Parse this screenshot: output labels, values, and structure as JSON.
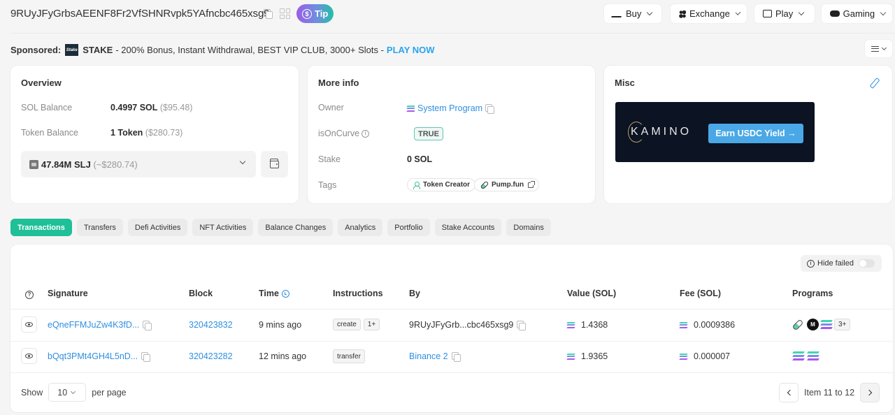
{
  "header": {
    "address": "9RUyJFyGrbsAEENF8Fr2VfSHNRvpk5YAfncbc465xsg9",
    "tip_label": "Tip",
    "nav": [
      {
        "label": "Buy",
        "icon": "buy-icon"
      },
      {
        "label": "Exchange",
        "icon": "exchange-icon"
      },
      {
        "label": "Play",
        "icon": "play-icon"
      },
      {
        "label": "Gaming",
        "icon": "gamepad-icon"
      }
    ]
  },
  "sponsored": {
    "label": "Sponsored:",
    "brand": "STAKE",
    "logo_text": "Stake",
    "text": "- 200% Bonus, Instant Withdrawal, BEST VIP CLUB, 3000+ Slots -",
    "cta": "PLAY NOW"
  },
  "overview": {
    "title": "Overview",
    "sol_balance_label": "SOL Balance",
    "sol_balance_value": "0.4997 SOL",
    "sol_balance_usd": "($95.48)",
    "token_balance_label": "Token Balance",
    "token_balance_value": "1 Token",
    "token_balance_usd": "($280.73)",
    "token_select_value": "47.84M SLJ",
    "token_select_usd": "(~$280.74)"
  },
  "more_info": {
    "title": "More info",
    "owner_label": "Owner",
    "owner_value": "System Program",
    "is_on_curve_label": "isOnCurve",
    "is_on_curve_value": "TRUE",
    "stake_label": "Stake",
    "stake_value": "0 SOL",
    "tags_label": "Tags",
    "tags": [
      "Token Creator",
      "Pump.fun"
    ]
  },
  "misc": {
    "title": "Misc",
    "ad_brand": "KAMINO",
    "ad_cta": "Earn USDC Yield →"
  },
  "tabs": [
    {
      "label": "Transactions",
      "active": true
    },
    {
      "label": "Transfers"
    },
    {
      "label": "Defi Activities"
    },
    {
      "label": "NFT Activities"
    },
    {
      "label": "Balance Changes"
    },
    {
      "label": "Analytics"
    },
    {
      "label": "Portfolio"
    },
    {
      "label": "Stake Accounts"
    },
    {
      "label": "Domains"
    }
  ],
  "table": {
    "hide_failed_label": "Hide failed",
    "hide_failed_on": false,
    "columns": [
      "Signature",
      "Block",
      "Time",
      "Instructions",
      "By",
      "Value (SOL)",
      "Fee (SOL)",
      "Programs"
    ],
    "rows": [
      {
        "signature": "eQneFFMJuZw4K3fD...",
        "block": "320423832",
        "time": "9 mins ago",
        "instructions": [
          "create",
          "1+"
        ],
        "by": "9RUyJFyGrb...cbc465xsg9",
        "by_is_link": false,
        "value": "1.4368",
        "fee": "0.0009386",
        "programs": [
          "pump-pill-icon",
          "dark-m-icon",
          "solana-icon"
        ],
        "programs_more": "3+"
      },
      {
        "signature": "bQqt3PMt4GH4L5nD...",
        "block": "320423282",
        "time": "12 mins ago",
        "instructions": [
          "transfer"
        ],
        "by": "Binance 2",
        "by_is_link": true,
        "value": "1.9365",
        "fee": "0.000007",
        "programs": [
          "solana-icon",
          "solana-icon"
        ],
        "programs_more": ""
      }
    ]
  },
  "pagination": {
    "show_label": "Show",
    "per_page_value": "10",
    "per_page_label": "per page",
    "range_text": "Item 11 to 12"
  },
  "colors": {
    "accent": "#1fbf98",
    "link": "#2f8fe0",
    "play_now": "#2aa3ef"
  }
}
